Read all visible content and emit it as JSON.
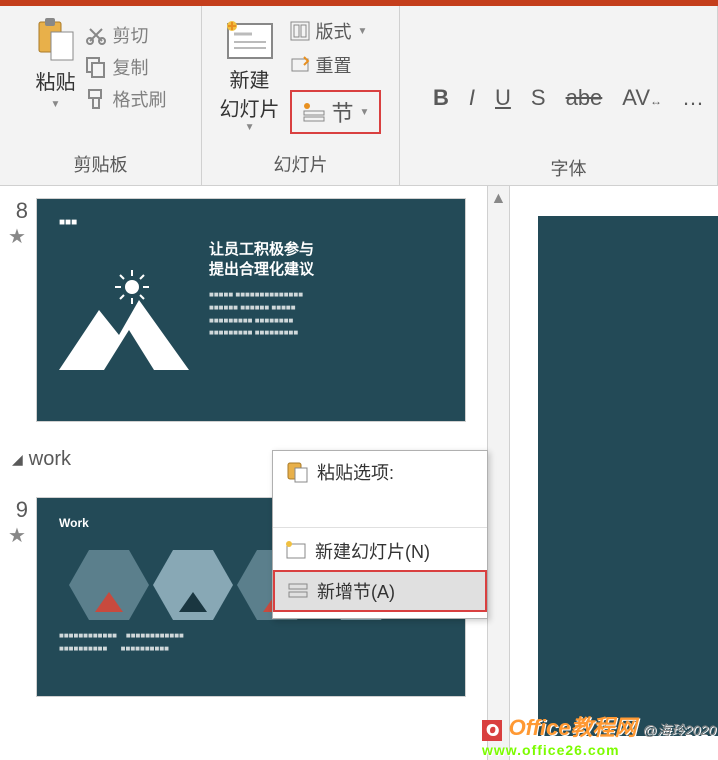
{
  "ribbon": {
    "clipboard": {
      "paste": "粘贴",
      "cut": "剪切",
      "copy": "复制",
      "format_painter": "格式刷",
      "group_label": "剪贴板"
    },
    "slides": {
      "new_slide": "新建\n幻灯片",
      "layout": "版式",
      "reset": "重置",
      "section": "节",
      "group_label": "幻灯片"
    },
    "font": {
      "bold": "B",
      "italic": "I",
      "underline": "U",
      "shadow": "S",
      "strike": "abe",
      "spacing": "AV",
      "group_label": "字体"
    }
  },
  "thumbs": {
    "slide8": {
      "num": "8",
      "title_line1": "让员工积极参与",
      "title_line2": "提出合理化建议"
    },
    "section_work": "work",
    "slide9": {
      "num": "9",
      "label": "Work"
    }
  },
  "context_menu": {
    "paste_options": "粘贴选项:",
    "new_slide": "新建幻灯片(N)",
    "add_section": "新增节(A)"
  },
  "watermark": {
    "title": "Office教程网",
    "handle": "@海玲2020",
    "site": "www.office26.com"
  }
}
